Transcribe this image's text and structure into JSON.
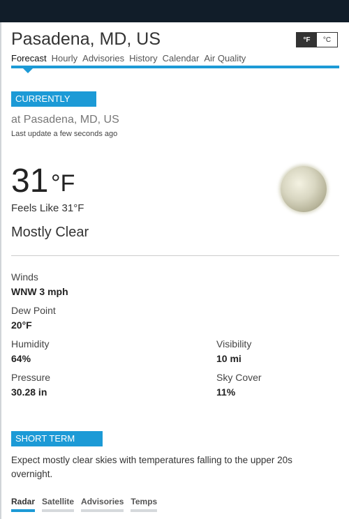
{
  "header": {
    "location": "Pasadena, MD, US"
  },
  "unit_toggle": {
    "f_label": "°F",
    "c_label": "°C",
    "selected": "°F"
  },
  "tabs": [
    {
      "label": "Forecast"
    },
    {
      "label": "Hourly"
    },
    {
      "label": "Advisories"
    },
    {
      "label": "History"
    },
    {
      "label": "Calendar"
    },
    {
      "label": "Air Quality"
    }
  ],
  "currently": {
    "section_label": "CURRENTLY",
    "location": "at Pasadena, MD, US",
    "last_update": "Last update a few seconds ago",
    "temperature": "31",
    "temperature_unit": "°F",
    "feels_like": "Feels Like 31°F",
    "condition": "Mostly Clear",
    "icon": "moon-icon"
  },
  "metrics": {
    "winds_label": "Winds",
    "winds_value": "WNW 3 mph",
    "dew_point_label": "Dew Point",
    "dew_point_value": "20°F",
    "humidity_label": "Humidity",
    "humidity_value": "64%",
    "visibility_label": "Visibility",
    "visibility_value": "10 mi",
    "pressure_label": "Pressure",
    "pressure_value": "30.28 in",
    "sky_cover_label": "Sky Cover",
    "sky_cover_value": "11%"
  },
  "short_term": {
    "section_label": "SHORT TERM",
    "text": "Expect mostly clear skies with temperatures falling to the upper 20s overnight."
  },
  "bottom_tabs": [
    {
      "label": "Radar"
    },
    {
      "label": "Satellite"
    },
    {
      "label": "Advisories"
    },
    {
      "label": "Temps"
    }
  ],
  "colors": {
    "accent": "#1c9ad6",
    "topbar": "#111d29"
  }
}
